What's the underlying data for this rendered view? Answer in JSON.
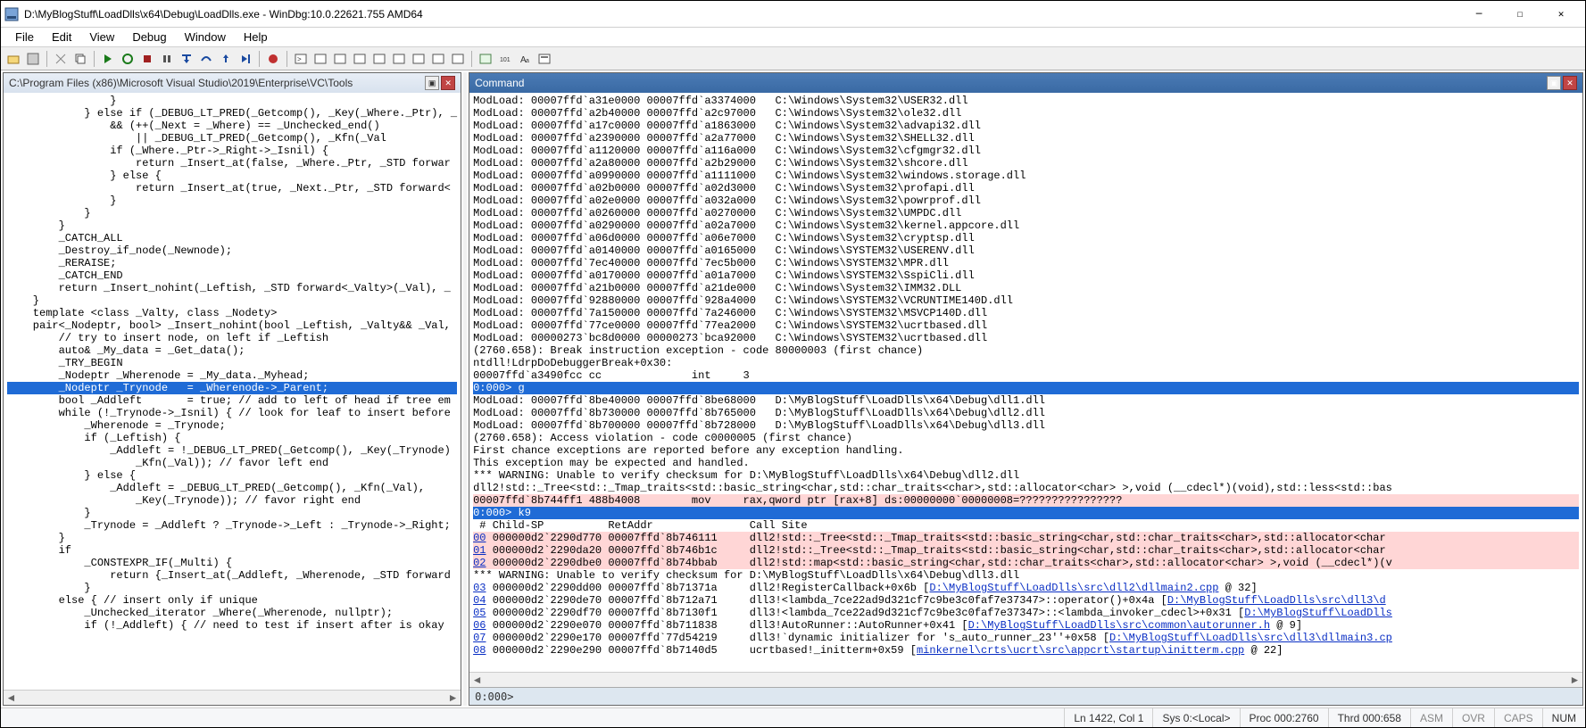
{
  "window": {
    "title": "D:\\MyBlogStuff\\LoadDlls\\x64\\Debug\\LoadDlls.exe - WinDbg:10.0.22621.755 AMD64"
  },
  "menu": {
    "items": [
      "File",
      "Edit",
      "View",
      "Debug",
      "Window",
      "Help"
    ]
  },
  "panes": {
    "source_title": "C:\\Program Files (x86)\\Microsoft Visual Studio\\2019\\Enterprise\\VC\\Tools",
    "command_title": "Command"
  },
  "source_lines": [
    {
      "t": "                }"
    },
    {
      "t": "            } else if (_DEBUG_LT_PRED(_Getcomp(), _Key(_Where._Ptr), _"
    },
    {
      "t": "                && (++(_Next = _Where) == _Unchecked_end()"
    },
    {
      "t": "                    || _DEBUG_LT_PRED(_Getcomp(), _Kfn(_Val"
    },
    {
      "t": "                if (_Where._Ptr->_Right->_Isnil) {"
    },
    {
      "t": "                    return _Insert_at(false, _Where._Ptr, _STD forwar"
    },
    {
      "t": "                } else {"
    },
    {
      "t": "                    return _Insert_at(true, _Next._Ptr, _STD forward<"
    },
    {
      "t": "                }"
    },
    {
      "t": "            }"
    },
    {
      "t": "        }"
    },
    {
      "t": "        _CATCH_ALL"
    },
    {
      "t": "        _Destroy_if_node(_Newnode);"
    },
    {
      "t": "        _RERAISE;"
    },
    {
      "t": "        _CATCH_END"
    },
    {
      "t": ""
    },
    {
      "t": "        return _Insert_nohint(_Leftish, _STD forward<_Valty>(_Val), _"
    },
    {
      "t": "    }"
    },
    {
      "t": ""
    },
    {
      "t": "    template <class _Valty, class _Nodety>"
    },
    {
      "t": "    pair<_Nodeptr, bool> _Insert_nohint(bool _Leftish, _Valty&& _Val,"
    },
    {
      "t": "        // try to insert node, on left if _Leftish"
    },
    {
      "t": "        auto& _My_data = _Get_data();"
    },
    {
      "t": "        _TRY_BEGIN"
    },
    {
      "t": "        _Nodeptr _Wherenode = _My_data._Myhead;"
    },
    {
      "t": "        _Nodeptr _Trynode   = _Wherenode->_Parent;",
      "hl": true
    },
    {
      "t": "        bool _Addleft       = true; // add to left of head if tree em"
    },
    {
      "t": ""
    },
    {
      "t": "        while (!_Trynode->_Isnil) { // look for leaf to insert before"
    },
    {
      "t": "            _Wherenode = _Trynode;"
    },
    {
      "t": "            if (_Leftish) {"
    },
    {
      "t": "                _Addleft = !_DEBUG_LT_PRED(_Getcomp(), _Key(_Trynode)"
    },
    {
      "t": "                    _Kfn(_Val)); // favor left end"
    },
    {
      "t": "            } else {"
    },
    {
      "t": "                _Addleft = _DEBUG_LT_PRED(_Getcomp(), _Kfn(_Val),"
    },
    {
      "t": "                    _Key(_Trynode)); // favor right end"
    },
    {
      "t": "            }"
    },
    {
      "t": "            _Trynode = _Addleft ? _Trynode->_Left : _Trynode->_Right;"
    },
    {
      "t": "        }"
    },
    {
      "t": ""
    },
    {
      "t": "        if"
    },
    {
      "t": ""
    },
    {
      "t": "            _CONSTEXPR_IF(_Multi) {"
    },
    {
      "t": "                return {_Insert_at(_Addleft, _Wherenode, _STD forward"
    },
    {
      "t": "            }"
    },
    {
      "t": "        else { // insert only if unique"
    },
    {
      "t": "            _Unchecked_iterator _Where(_Wherenode, nullptr);"
    },
    {
      "t": "            if (!_Addleft) { // need to test if insert after is okay"
    }
  ],
  "command_lines": [
    {
      "t": "ModLoad: 00007ffd`a31e0000 00007ffd`a3374000   C:\\Windows\\System32\\USER32.dll"
    },
    {
      "t": "ModLoad: 00007ffd`a2b40000 00007ffd`a2c97000   C:\\Windows\\System32\\ole32.dll"
    },
    {
      "t": "ModLoad: 00007ffd`a17c0000 00007ffd`a1863000   C:\\Windows\\System32\\advapi32.dll"
    },
    {
      "t": "ModLoad: 00007ffd`a2390000 00007ffd`a2a77000   C:\\Windows\\System32\\SHELL32.dll"
    },
    {
      "t": "ModLoad: 00007ffd`a1120000 00007ffd`a116a000   C:\\Windows\\System32\\cfgmgr32.dll"
    },
    {
      "t": "ModLoad: 00007ffd`a2a80000 00007ffd`a2b29000   C:\\Windows\\System32\\shcore.dll"
    },
    {
      "t": "ModLoad: 00007ffd`a0990000 00007ffd`a1111000   C:\\Windows\\System32\\windows.storage.dll"
    },
    {
      "t": "ModLoad: 00007ffd`a02b0000 00007ffd`a02d3000   C:\\Windows\\System32\\profapi.dll"
    },
    {
      "t": "ModLoad: 00007ffd`a02e0000 00007ffd`a032a000   C:\\Windows\\System32\\powrprof.dll"
    },
    {
      "t": "ModLoad: 00007ffd`a0260000 00007ffd`a0270000   C:\\Windows\\System32\\UMPDC.dll"
    },
    {
      "t": "ModLoad: 00007ffd`a0290000 00007ffd`a02a7000   C:\\Windows\\System32\\kernel.appcore.dll"
    },
    {
      "t": "ModLoad: 00007ffd`a06d0000 00007ffd`a06e7000   C:\\Windows\\System32\\cryptsp.dll"
    },
    {
      "t": "ModLoad: 00007ffd`a0140000 00007ffd`a0165000   C:\\Windows\\SYSTEM32\\USERENV.dll"
    },
    {
      "t": "ModLoad: 00007ffd`7ec40000 00007ffd`7ec5b000   C:\\Windows\\SYSTEM32\\MPR.dll"
    },
    {
      "t": "ModLoad: 00007ffd`a0170000 00007ffd`a01a7000   C:\\Windows\\SYSTEM32\\SspiCli.dll"
    },
    {
      "t": "ModLoad: 00007ffd`a21b0000 00007ffd`a21de000   C:\\Windows\\System32\\IMM32.DLL"
    },
    {
      "t": "ModLoad: 00007ffd`92880000 00007ffd`928a4000   C:\\Windows\\SYSTEM32\\VCRUNTIME140D.dll"
    },
    {
      "t": "ModLoad: 00007ffd`7a150000 00007ffd`7a246000   C:\\Windows\\SYSTEM32\\MSVCP140D.dll"
    },
    {
      "t": "ModLoad: 00007ffd`77ce0000 00007ffd`77ea2000   C:\\Windows\\SYSTEM32\\ucrtbased.dll"
    },
    {
      "t": "ModLoad: 00000273`bc8d0000 00000273`bca92000   C:\\Windows\\SYSTEM32\\ucrtbased.dll"
    },
    {
      "t": "(2760.658): Break instruction exception - code 80000003 (first chance)"
    },
    {
      "t": "ntdll!LdrpDoDebuggerBreak+0x30:"
    },
    {
      "t": "00007ffd`a3490fcc cc              int     3"
    },
    {
      "t": "0:000> g",
      "blue": true
    },
    {
      "t": "ModLoad: 00007ffd`8be40000 00007ffd`8be68000   D:\\MyBlogStuff\\LoadDlls\\x64\\Debug\\dll1.dll"
    },
    {
      "t": "ModLoad: 00007ffd`8b730000 00007ffd`8b765000   D:\\MyBlogStuff\\LoadDlls\\x64\\Debug\\dll2.dll"
    },
    {
      "t": "ModLoad: 00007ffd`8b700000 00007ffd`8b728000   D:\\MyBlogStuff\\LoadDlls\\x64\\Debug\\dll3.dll"
    },
    {
      "t": "(2760.658): Access violation - code c0000005 (first chance)"
    },
    {
      "t": "First chance exceptions are reported before any exception handling."
    },
    {
      "t": "This exception may be expected and handled."
    },
    {
      "t": "*** WARNING: Unable to verify checksum for D:\\MyBlogStuff\\LoadDlls\\x64\\Debug\\dll2.dll"
    },
    {
      "t": "dll2!std::_Tree<std::_Tmap_traits<std::basic_string<char,std::char_traits<char>,std::allocator<char> >,void (__cdecl*)(void),std::less<std::bas"
    },
    {
      "t": "00007ffd`8b744ff1 488b4008        mov     rax,qword ptr [rax+8] ds:00000000`00000008=????????????????",
      "pink": true
    },
    {
      "t": "0:000> k9",
      "blue": true
    },
    {
      "t": " # Child-SP          RetAddr               Call Site"
    },
    {
      "t": "00 000000d2`2290d770 00007ffd`8b746111     dll2!std::_Tree<std::_Tmap_traits<std::basic_string<char,std::char_traits<char>,std::allocator<char",
      "pink": true,
      "framelink": true,
      "frame": "00"
    },
    {
      "t": "01 000000d2`2290da20 00007ffd`8b746b1c     dll2!std::_Tree<std::_Tmap_traits<std::basic_string<char,std::char_traits<char>,std::allocator<char",
      "pink": true,
      "framelink": true,
      "frame": "01"
    },
    {
      "t": "02 000000d2`2290dbe0 00007ffd`8b74bbab     dll2!std::map<std::basic_string<char,std::char_traits<char>,std::allocator<char> >,void (__cdecl*)(v",
      "pink": true,
      "framelink": true,
      "frame": "02"
    },
    {
      "t": "*** WARNING: Unable to verify checksum for D:\\MyBlogStuff\\LoadDlls\\x64\\Debug\\dll3.dll"
    },
    {
      "pieces": [
        {
          "type": "link",
          "txt": "03"
        },
        {
          "type": "txt",
          "txt": " 000000d2`2290dd00 00007ffd`8b71371a     dll2!RegisterCallback+0x6b ["
        },
        {
          "type": "link",
          "txt": "D:\\MyBlogStuff\\LoadDlls\\src\\dll2\\dllmain2.cpp"
        },
        {
          "type": "txt",
          "txt": " @ 32]"
        }
      ]
    },
    {
      "pieces": [
        {
          "type": "link",
          "txt": "04"
        },
        {
          "type": "txt",
          "txt": " 000000d2`2290de70 00007ffd`8b712a71     dll3!<lambda_7ce22ad9d321cf7c9be3c0faf7e37347>::operator()+0x4a ["
        },
        {
          "type": "link",
          "txt": "D:\\MyBlogStuff\\LoadDlls\\src\\dll3\\d"
        }
      ]
    },
    {
      "pieces": [
        {
          "type": "link",
          "txt": "05"
        },
        {
          "type": "txt",
          "txt": " 000000d2`2290df70 00007ffd`8b7130f1     dll3!<lambda_7ce22ad9d321cf7c9be3c0faf7e37347>::<lambda_invoker_cdecl>+0x31 ["
        },
        {
          "type": "link",
          "txt": "D:\\MyBlogStuff\\LoadDlls"
        }
      ]
    },
    {
      "pieces": [
        {
          "type": "link",
          "txt": "06"
        },
        {
          "type": "txt",
          "txt": " 000000d2`2290e070 00007ffd`8b711838     dll3!AutoRunner::AutoRunner+0x41 ["
        },
        {
          "type": "link",
          "txt": "D:\\MyBlogStuff\\LoadDlls\\src\\common\\autorunner.h"
        },
        {
          "type": "txt",
          "txt": " @ 9]"
        }
      ]
    },
    {
      "pieces": [
        {
          "type": "link",
          "txt": "07"
        },
        {
          "type": "txt",
          "txt": " 000000d2`2290e170 00007ffd`77d54219     dll3!`dynamic initializer for 's_auto_runner_23''+0x58 ["
        },
        {
          "type": "link",
          "txt": "D:\\MyBlogStuff\\LoadDlls\\src\\dll3\\dllmain3.cp"
        }
      ]
    },
    {
      "pieces": [
        {
          "type": "link",
          "txt": "08"
        },
        {
          "type": "txt",
          "txt": " 000000d2`2290e290 00007ffd`8b7140d5     ucrtbased!_initterm+0x59 ["
        },
        {
          "type": "link",
          "txt": "minkernel\\crts\\ucrt\\src\\appcrt\\startup\\initterm.cpp"
        },
        {
          "type": "txt",
          "txt": " @ 22]"
        }
      ]
    }
  ],
  "command_prompt": "0:000>",
  "statusbar": {
    "lncol": "Ln 1422, Col 1",
    "sys": "Sys 0:<Local>",
    "proc": "Proc 000:2760",
    "thrd": "Thrd 000:658",
    "asm": "ASM",
    "ovr": "OVR",
    "caps": "CAPS",
    "num": "NUM"
  }
}
